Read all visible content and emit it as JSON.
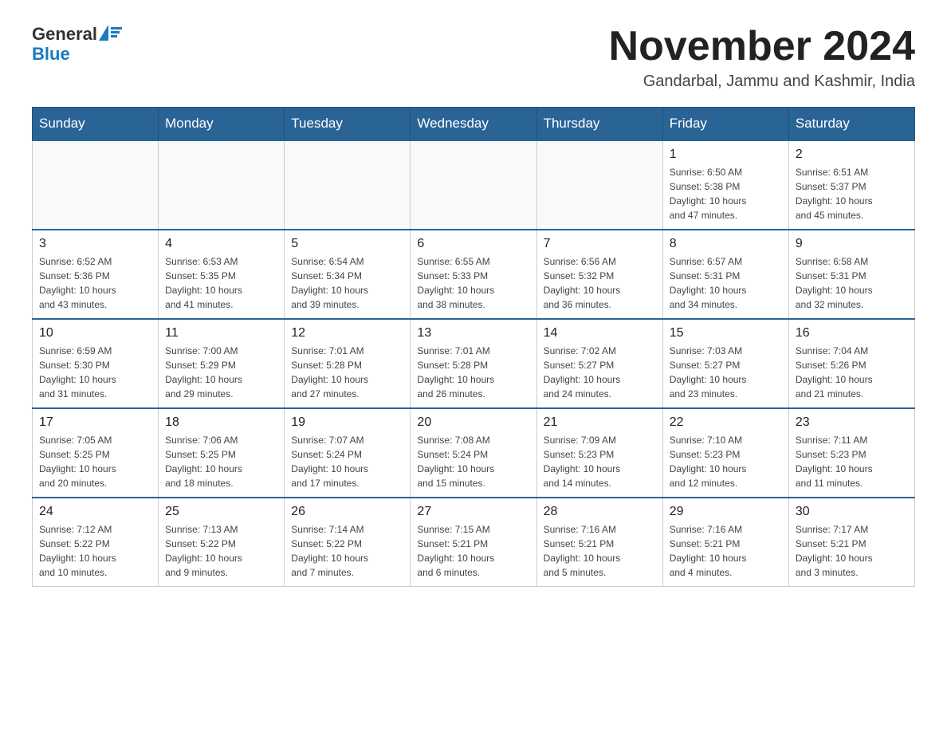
{
  "logo": {
    "text_general": "General",
    "text_blue": "Blue"
  },
  "header": {
    "month_year": "November 2024",
    "location": "Gandarbal, Jammu and Kashmir, India"
  },
  "weekdays": [
    "Sunday",
    "Monday",
    "Tuesday",
    "Wednesday",
    "Thursday",
    "Friday",
    "Saturday"
  ],
  "weeks": [
    [
      {
        "day": "",
        "info": ""
      },
      {
        "day": "",
        "info": ""
      },
      {
        "day": "",
        "info": ""
      },
      {
        "day": "",
        "info": ""
      },
      {
        "day": "",
        "info": ""
      },
      {
        "day": "1",
        "info": "Sunrise: 6:50 AM\nSunset: 5:38 PM\nDaylight: 10 hours\nand 47 minutes."
      },
      {
        "day": "2",
        "info": "Sunrise: 6:51 AM\nSunset: 5:37 PM\nDaylight: 10 hours\nand 45 minutes."
      }
    ],
    [
      {
        "day": "3",
        "info": "Sunrise: 6:52 AM\nSunset: 5:36 PM\nDaylight: 10 hours\nand 43 minutes."
      },
      {
        "day": "4",
        "info": "Sunrise: 6:53 AM\nSunset: 5:35 PM\nDaylight: 10 hours\nand 41 minutes."
      },
      {
        "day": "5",
        "info": "Sunrise: 6:54 AM\nSunset: 5:34 PM\nDaylight: 10 hours\nand 39 minutes."
      },
      {
        "day": "6",
        "info": "Sunrise: 6:55 AM\nSunset: 5:33 PM\nDaylight: 10 hours\nand 38 minutes."
      },
      {
        "day": "7",
        "info": "Sunrise: 6:56 AM\nSunset: 5:32 PM\nDaylight: 10 hours\nand 36 minutes."
      },
      {
        "day": "8",
        "info": "Sunrise: 6:57 AM\nSunset: 5:31 PM\nDaylight: 10 hours\nand 34 minutes."
      },
      {
        "day": "9",
        "info": "Sunrise: 6:58 AM\nSunset: 5:31 PM\nDaylight: 10 hours\nand 32 minutes."
      }
    ],
    [
      {
        "day": "10",
        "info": "Sunrise: 6:59 AM\nSunset: 5:30 PM\nDaylight: 10 hours\nand 31 minutes."
      },
      {
        "day": "11",
        "info": "Sunrise: 7:00 AM\nSunset: 5:29 PM\nDaylight: 10 hours\nand 29 minutes."
      },
      {
        "day": "12",
        "info": "Sunrise: 7:01 AM\nSunset: 5:28 PM\nDaylight: 10 hours\nand 27 minutes."
      },
      {
        "day": "13",
        "info": "Sunrise: 7:01 AM\nSunset: 5:28 PM\nDaylight: 10 hours\nand 26 minutes."
      },
      {
        "day": "14",
        "info": "Sunrise: 7:02 AM\nSunset: 5:27 PM\nDaylight: 10 hours\nand 24 minutes."
      },
      {
        "day": "15",
        "info": "Sunrise: 7:03 AM\nSunset: 5:27 PM\nDaylight: 10 hours\nand 23 minutes."
      },
      {
        "day": "16",
        "info": "Sunrise: 7:04 AM\nSunset: 5:26 PM\nDaylight: 10 hours\nand 21 minutes."
      }
    ],
    [
      {
        "day": "17",
        "info": "Sunrise: 7:05 AM\nSunset: 5:25 PM\nDaylight: 10 hours\nand 20 minutes."
      },
      {
        "day": "18",
        "info": "Sunrise: 7:06 AM\nSunset: 5:25 PM\nDaylight: 10 hours\nand 18 minutes."
      },
      {
        "day": "19",
        "info": "Sunrise: 7:07 AM\nSunset: 5:24 PM\nDaylight: 10 hours\nand 17 minutes."
      },
      {
        "day": "20",
        "info": "Sunrise: 7:08 AM\nSunset: 5:24 PM\nDaylight: 10 hours\nand 15 minutes."
      },
      {
        "day": "21",
        "info": "Sunrise: 7:09 AM\nSunset: 5:23 PM\nDaylight: 10 hours\nand 14 minutes."
      },
      {
        "day": "22",
        "info": "Sunrise: 7:10 AM\nSunset: 5:23 PM\nDaylight: 10 hours\nand 12 minutes."
      },
      {
        "day": "23",
        "info": "Sunrise: 7:11 AM\nSunset: 5:23 PM\nDaylight: 10 hours\nand 11 minutes."
      }
    ],
    [
      {
        "day": "24",
        "info": "Sunrise: 7:12 AM\nSunset: 5:22 PM\nDaylight: 10 hours\nand 10 minutes."
      },
      {
        "day": "25",
        "info": "Sunrise: 7:13 AM\nSunset: 5:22 PM\nDaylight: 10 hours\nand 9 minutes."
      },
      {
        "day": "26",
        "info": "Sunrise: 7:14 AM\nSunset: 5:22 PM\nDaylight: 10 hours\nand 7 minutes."
      },
      {
        "day": "27",
        "info": "Sunrise: 7:15 AM\nSunset: 5:21 PM\nDaylight: 10 hours\nand 6 minutes."
      },
      {
        "day": "28",
        "info": "Sunrise: 7:16 AM\nSunset: 5:21 PM\nDaylight: 10 hours\nand 5 minutes."
      },
      {
        "day": "29",
        "info": "Sunrise: 7:16 AM\nSunset: 5:21 PM\nDaylight: 10 hours\nand 4 minutes."
      },
      {
        "day": "30",
        "info": "Sunrise: 7:17 AM\nSunset: 5:21 PM\nDaylight: 10 hours\nand 3 minutes."
      }
    ]
  ]
}
